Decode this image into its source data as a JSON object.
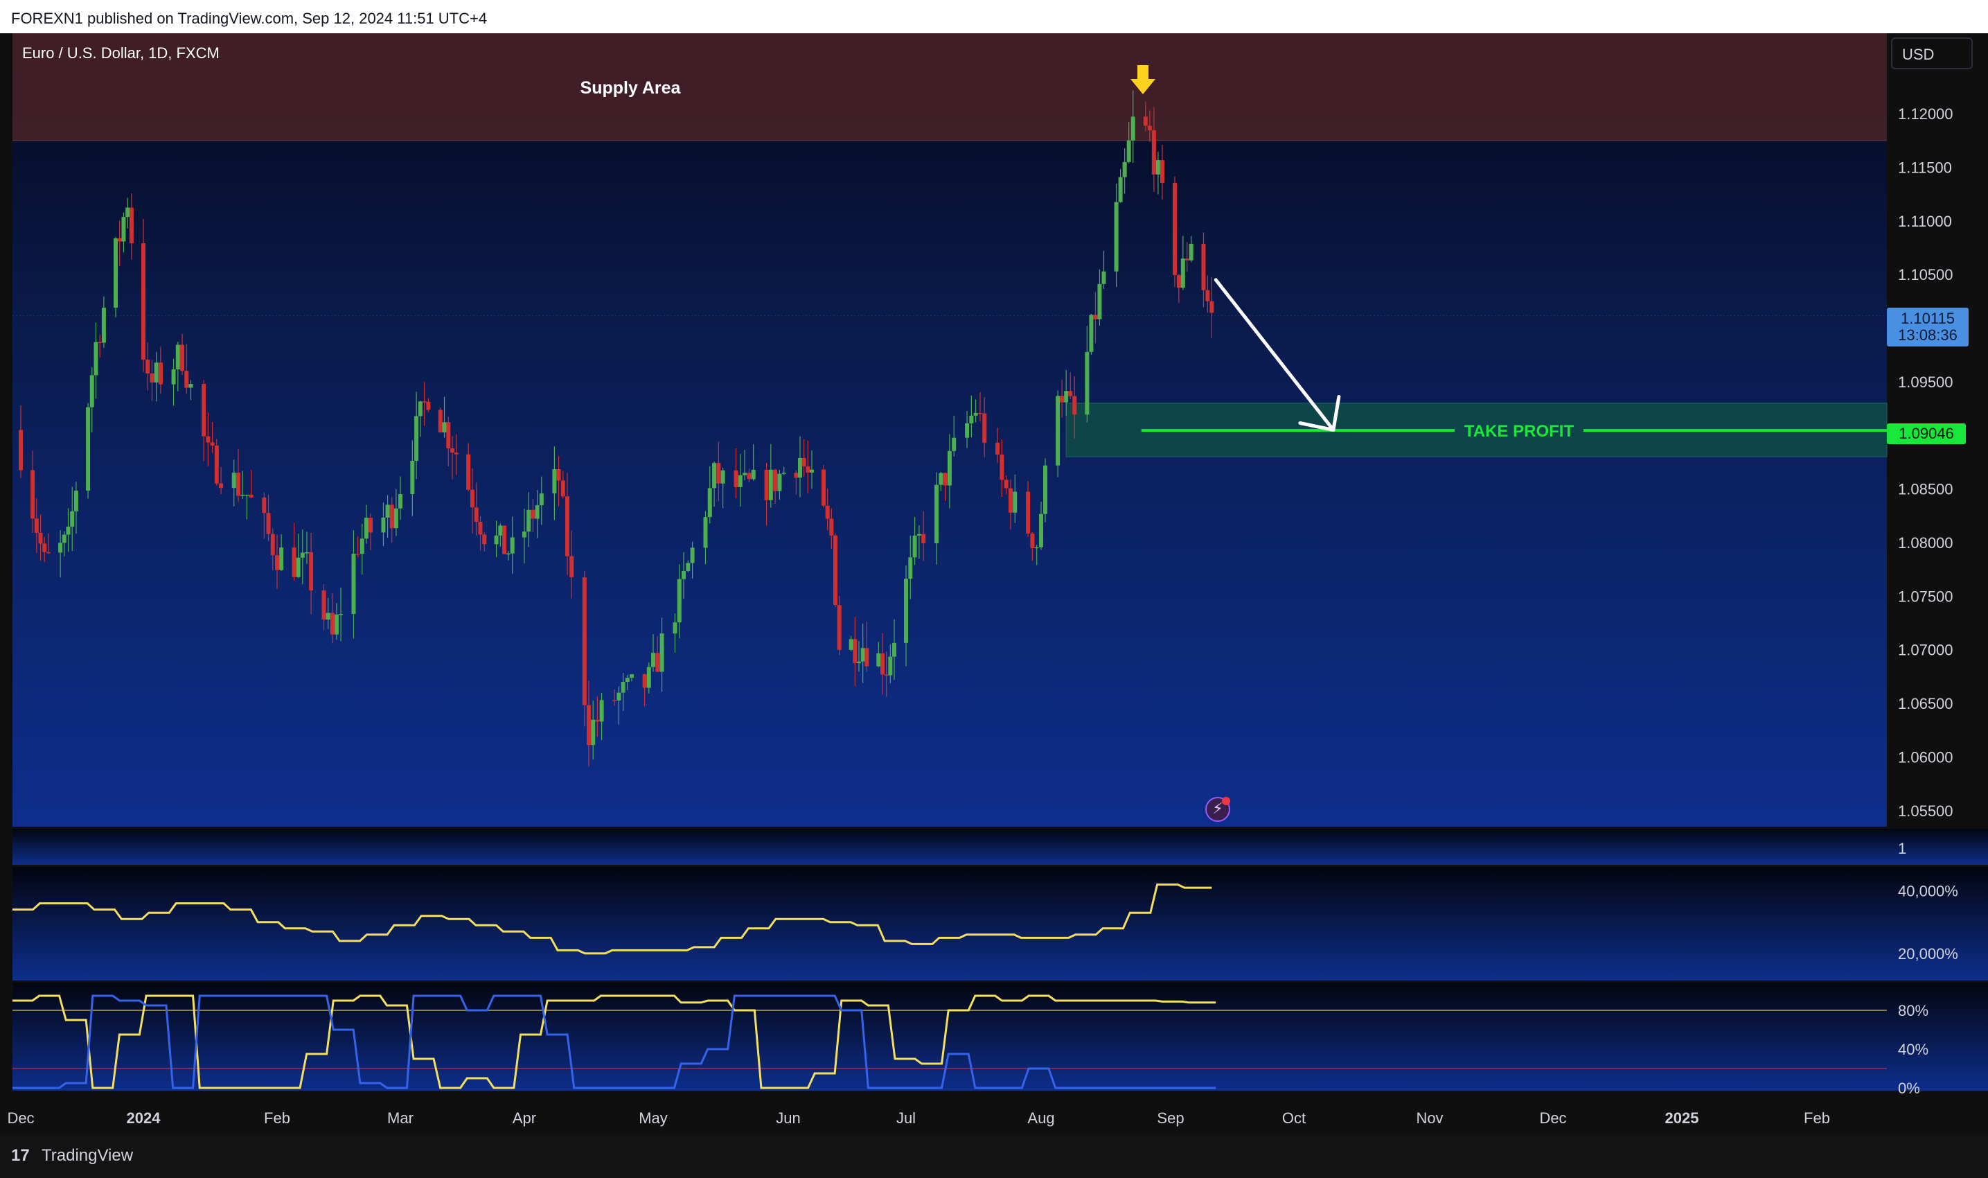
{
  "header": {
    "text": "FOREXN1 published on TradingView.com, Sep 12, 2024 11:51 UTC+4"
  },
  "footer": {
    "logo": "17",
    "brand": "TradingView"
  },
  "currency_button": "USD",
  "annotations": {
    "supply_label": "Supply Area",
    "take_profit_label": "TAKE PROFIT",
    "take_profit_price": "1.09046",
    "last_price": "1.10115",
    "countdown": "13:08:36"
  },
  "colors": {
    "up": "#4caf50",
    "down": "#d32f2f",
    "supply_zone": "#4a2228",
    "take_profit_zone": "#0e4a47",
    "take_profit_line": "#19e83a",
    "yellow_line": "#f5e05e",
    "blue_line": "#3563e9"
  },
  "chart_data": [
    {
      "type": "candlestick",
      "title": "Euro / U.S. Dollar, 1D, FXCM",
      "x_ticks": [
        "Dec",
        "2024",
        "Feb",
        "Mar",
        "Apr",
        "May",
        "Jun",
        "Jul",
        "Aug",
        "Sep",
        "Oct",
        "Nov",
        "Dec",
        "2025",
        "Feb"
      ],
      "y_ticks": [
        "1.12000",
        "1.11500",
        "1.11000",
        "1.10500",
        "1.09500",
        "1.08500",
        "1.08000",
        "1.07500",
        "1.07000",
        "1.06500",
        "1.06000",
        "1.05500"
      ],
      "ylim": [
        1.0535,
        1.1275
      ],
      "close_path": [
        [
          "2023-12-01",
          1.0885
        ],
        [
          "2023-12-07",
          1.078
        ],
        [
          "2023-12-13",
          1.08
        ],
        [
          "2023-12-20",
          1.0985
        ],
        [
          "2023-12-28",
          1.112
        ],
        [
          "2024-01-02",
          1.0945
        ],
        [
          "2024-01-10",
          1.0975
        ],
        [
          "2024-01-16",
          1.088
        ],
        [
          "2024-01-25",
          1.0845
        ],
        [
          "2024-02-01",
          1.079
        ],
        [
          "2024-02-08",
          1.0775
        ],
        [
          "2024-02-14",
          1.071
        ],
        [
          "2024-02-20",
          1.08
        ],
        [
          "2024-02-28",
          1.083
        ],
        [
          "2024-03-08",
          1.094
        ],
        [
          "2024-03-15",
          1.0885
        ],
        [
          "2024-03-22",
          1.081
        ],
        [
          "2024-03-29",
          1.079
        ],
        [
          "2024-04-04",
          1.0835
        ],
        [
          "2024-04-09",
          1.086
        ],
        [
          "2024-04-16",
          1.0625
        ],
        [
          "2024-04-22",
          1.0655
        ],
        [
          "2024-04-30",
          1.067
        ],
        [
          "2024-05-07",
          1.075
        ],
        [
          "2024-05-15",
          1.086
        ],
        [
          "2024-05-21",
          1.085
        ],
        [
          "2024-05-28",
          1.0855
        ],
        [
          "2024-06-04",
          1.088
        ],
        [
          "2024-06-12",
          1.0805
        ],
        [
          "2024-06-14",
          1.0705
        ],
        [
          "2024-06-20",
          1.0705
        ],
        [
          "2024-06-26",
          1.0685
        ],
        [
          "2024-07-03",
          1.079
        ],
        [
          "2024-07-12",
          1.0885
        ],
        [
          "2024-07-17",
          1.0925
        ],
        [
          "2024-07-23",
          1.0855
        ],
        [
          "2024-07-31",
          1.08
        ],
        [
          "2024-08-05",
          1.095
        ],
        [
          "2024-08-09",
          1.0915
        ],
        [
          "2024-08-14",
          1.1015
        ],
        [
          "2024-08-20",
          1.1125
        ],
        [
          "2024-08-23",
          1.119
        ],
        [
          "2024-08-27",
          1.118
        ],
        [
          "2024-09-03",
          1.104
        ],
        [
          "2024-09-06",
          1.1085
        ],
        [
          "2024-09-11",
          1.101
        ]
      ],
      "highlight_zones": [
        {
          "label": "Supply Area",
          "from": 1.1175,
          "to": 1.1275
        },
        {
          "label": "TAKE PROFIT",
          "from": 1.088,
          "to": 1.093,
          "line": 1.09046
        }
      ],
      "projection": {
        "from": [
          "2024-09-12",
          1.1045
        ],
        "to": [
          "2024-10-10",
          1.0905
        ]
      }
    },
    {
      "type": "line",
      "y_ticks": [
        "1"
      ],
      "series": []
    },
    {
      "type": "line",
      "y_ticks": [
        "40,000%",
        "20,000%"
      ],
      "ylim": [
        14,
        45
      ],
      "series": [
        {
          "values": [
            34,
            36,
            36,
            34,
            31,
            33,
            36,
            36,
            34,
            30,
            28,
            27,
            24,
            26,
            29,
            32,
            31,
            29,
            27,
            25,
            21,
            20,
            21,
            21,
            21,
            22,
            25,
            28,
            31,
            31,
            30,
            29,
            24,
            23,
            25,
            26,
            26,
            25,
            25,
            26,
            28,
            33,
            42,
            41,
            41
          ]
        }
      ]
    },
    {
      "type": "line",
      "y_ticks": [
        "80%",
        "40%",
        "0%"
      ],
      "ylim": [
        0,
        100
      ],
      "reference_lines": [
        80,
        20
      ],
      "series": [
        {
          "values": [
            90,
            95,
            70,
            0,
            55,
            95,
            95,
            0,
            0,
            0,
            0,
            35,
            90,
            95,
            85,
            30,
            0,
            10,
            0,
            55,
            90,
            90,
            95,
            95,
            95,
            88,
            90,
            80,
            0,
            0,
            15,
            90,
            85,
            30,
            25,
            80,
            95,
            90,
            95,
            90,
            90,
            90,
            90,
            89,
            88,
            88
          ]
        },
        {
          "values": [
            0,
            0,
            5,
            95,
            90,
            85,
            0,
            95,
            95,
            95,
            95,
            95,
            60,
            5,
            0,
            95,
            95,
            80,
            95,
            95,
            55,
            0,
            0,
            0,
            0,
            25,
            40,
            95,
            95,
            95,
            95,
            80,
            0,
            0,
            0,
            35,
            0,
            0,
            20,
            0,
            0,
            0,
            0,
            0,
            0,
            0
          ]
        }
      ]
    }
  ]
}
